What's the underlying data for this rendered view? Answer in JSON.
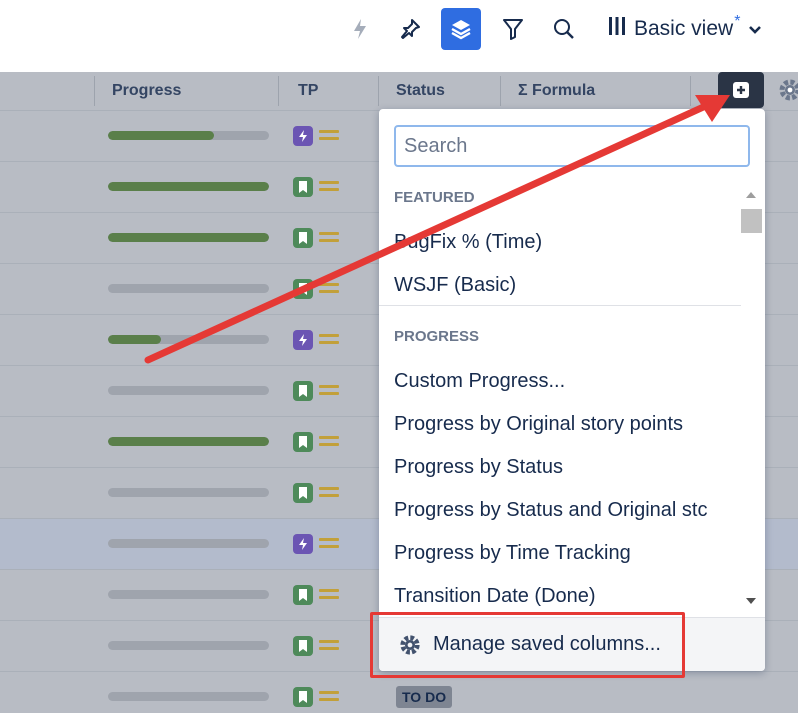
{
  "toolbar": {
    "view_label": "Basic view",
    "view_modified_mark": "*",
    "icons": [
      "bolt-icon",
      "pin-icon",
      "layers-icon",
      "filter-icon",
      "search-icon",
      "columns-icon",
      "chevron-down-icon"
    ]
  },
  "columns": [
    {
      "key": "progress",
      "label": "Progress"
    },
    {
      "key": "tp",
      "label": "TP"
    },
    {
      "key": "status",
      "label": "Status"
    },
    {
      "key": "formula",
      "label": "Σ Formula"
    }
  ],
  "rows": [
    {
      "progress": 0.66,
      "type": "epic"
    },
    {
      "progress": 1.0,
      "type": "story"
    },
    {
      "progress": 1.0,
      "type": "story"
    },
    {
      "progress": 0.0,
      "type": "story"
    },
    {
      "progress": 0.33,
      "type": "epic"
    },
    {
      "progress": 0.0,
      "type": "story"
    },
    {
      "progress": 1.0,
      "type": "story"
    },
    {
      "progress": 0.0,
      "type": "story"
    },
    {
      "progress": 0.0,
      "type": "epic",
      "highlight": true
    },
    {
      "progress": 0.0,
      "type": "story"
    },
    {
      "progress": 0.0,
      "type": "story"
    },
    {
      "progress": 0.0,
      "type": "story",
      "status": "TO DO"
    }
  ],
  "dropdown": {
    "search_placeholder": "Search",
    "featured_header": "FEATURED",
    "featured": [
      "BugFix % (Time)",
      "WSJF (Basic)"
    ],
    "progress_header": "PROGRESS",
    "progress_items": [
      "Custom Progress...",
      "Progress by Original story points",
      "Progress by Status",
      "Progress by Status and Original stc",
      "Progress by Time Tracking",
      "Transition Date (Done)"
    ],
    "manage_label": "Manage saved columns..."
  },
  "colors": {
    "accent": "#2f6de1",
    "annotation": "#e53935",
    "progress_fill": "#5a7f4a",
    "epic": "#6b55b3",
    "story": "#4e8a5a"
  }
}
